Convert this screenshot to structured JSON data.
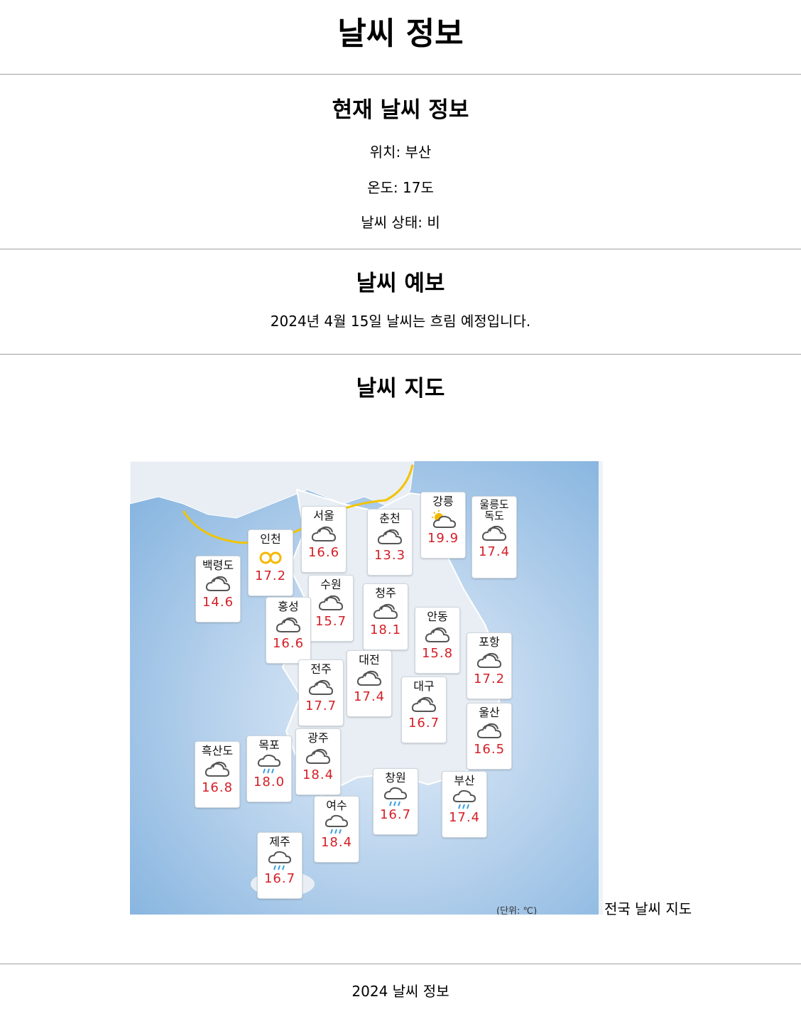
{
  "header": {
    "title": "날씨 정보"
  },
  "current": {
    "heading": "현재 날씨 정보",
    "location": "위치: 부산",
    "temperature": "온도: 17도",
    "condition": "날씨 상태: 비"
  },
  "forecast": {
    "heading": "날씨 예보",
    "text": "2024년 4월 15일 날씨는 흐림 예정입니다."
  },
  "map_section": {
    "heading": "날씨 지도",
    "caption": "전국 날씨 지도",
    "unit": "(단위: ℃)",
    "colors": {
      "temp_text": "#d41f26",
      "sea": "#7fb0dd",
      "land": "#e8eef4",
      "border_line": "#f2c400"
    },
    "cities": [
      {
        "name": "백령도",
        "temp": "14.6",
        "icon": "cloudy-icon"
      },
      {
        "name": "인천",
        "temp": "17.2",
        "icon": "haze-icon"
      },
      {
        "name": "서울",
        "temp": "16.6",
        "icon": "cloudy-icon"
      },
      {
        "name": "춘천",
        "temp": "13.3",
        "icon": "cloudy-icon"
      },
      {
        "name": "강릉",
        "temp": "19.9",
        "icon": "partly-cloudy-icon"
      },
      {
        "name": "울릉도\n독도",
        "temp": "17.4",
        "icon": "cloudy-icon"
      },
      {
        "name": "수원",
        "temp": "15.7",
        "icon": "cloudy-icon"
      },
      {
        "name": "청주",
        "temp": "18.1",
        "icon": "cloudy-icon"
      },
      {
        "name": "홍성",
        "temp": "16.6",
        "icon": "cloudy-icon"
      },
      {
        "name": "안동",
        "temp": "15.8",
        "icon": "cloudy-icon"
      },
      {
        "name": "포항",
        "temp": "17.2",
        "icon": "cloudy-icon"
      },
      {
        "name": "전주",
        "temp": "17.7",
        "icon": "cloudy-icon"
      },
      {
        "name": "대전",
        "temp": "17.4",
        "icon": "cloudy-icon"
      },
      {
        "name": "대구",
        "temp": "16.7",
        "icon": "cloudy-icon"
      },
      {
        "name": "울산",
        "temp": "16.5",
        "icon": "cloudy-icon"
      },
      {
        "name": "흑산도",
        "temp": "16.8",
        "icon": "cloudy-icon"
      },
      {
        "name": "목포",
        "temp": "18.0",
        "icon": "rain-icon"
      },
      {
        "name": "광주",
        "temp": "18.4",
        "icon": "cloudy-icon"
      },
      {
        "name": "창원",
        "temp": "16.7",
        "icon": "rain-icon"
      },
      {
        "name": "부산",
        "temp": "17.4",
        "icon": "rain-icon"
      },
      {
        "name": "여수",
        "temp": "18.4",
        "icon": "rain-icon"
      },
      {
        "name": "제주",
        "temp": "16.7",
        "icon": "rain-icon"
      }
    ]
  },
  "footer": {
    "text": "2024 날씨 정보"
  }
}
